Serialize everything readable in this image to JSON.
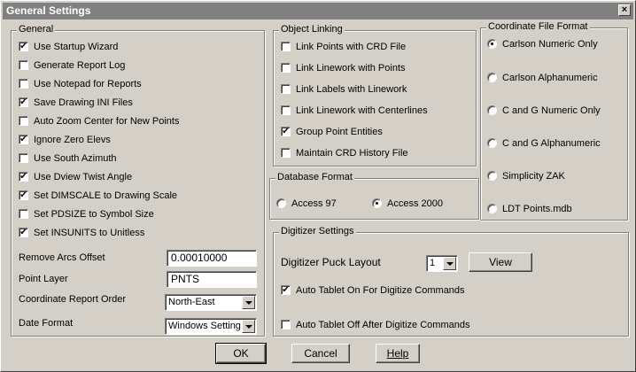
{
  "window": {
    "title": "General Settings",
    "close_glyph": "×"
  },
  "general": {
    "legend": "General",
    "items": [
      {
        "label": "Use Startup Wizard",
        "checked": true
      },
      {
        "label": "Generate Report Log",
        "checked": false
      },
      {
        "label": "Use Notepad for Reports",
        "checked": false
      },
      {
        "label": "Save Drawing INI Files",
        "checked": true
      },
      {
        "label": "Auto Zoom Center for New Points",
        "checked": false
      },
      {
        "label": "Ignore Zero Elevs",
        "checked": true
      },
      {
        "label": "Use South Azimuth",
        "checked": false
      },
      {
        "label": "Use Dview Twist Angle",
        "checked": true
      },
      {
        "label": "Set DIMSCALE to Drawing Scale",
        "checked": true
      },
      {
        "label": "Set PDSIZE to Symbol Size",
        "checked": false
      },
      {
        "label": "Set INSUNITS to Unitless",
        "checked": true
      }
    ],
    "remove_arcs_label": "Remove Arcs Offset",
    "remove_arcs_value": "0.00010000",
    "point_layer_label": "Point Layer",
    "point_layer_value": "PNTS",
    "coord_order_label": "Coordinate Report Order",
    "coord_order_value": "North-East",
    "date_format_label": "Date Format",
    "date_format_value": "Windows Setting"
  },
  "object_linking": {
    "legend": "Object Linking",
    "items": [
      {
        "label": "Link Points with CRD File",
        "checked": false
      },
      {
        "label": "Link Linework with Points",
        "checked": false
      },
      {
        "label": "Link Labels with Linework",
        "checked": false
      },
      {
        "label": "Link Linework with Centerlines",
        "checked": false
      },
      {
        "label": "Group Point Entities",
        "checked": true
      },
      {
        "label": "Maintain CRD History File",
        "checked": false
      }
    ]
  },
  "database_format": {
    "legend": "Database Format",
    "options": [
      {
        "label": "Access 97",
        "selected": false
      },
      {
        "label": "Access 2000",
        "selected": true
      }
    ]
  },
  "coord_file_format": {
    "legend": "Coordinate File Format",
    "options": [
      {
        "label": "Carlson Numeric Only",
        "selected": true
      },
      {
        "label": "Carlson Alphanumeric",
        "selected": false
      },
      {
        "label": "C and G Numeric Only",
        "selected": false
      },
      {
        "label": "C and G Alphanumeric",
        "selected": false
      },
      {
        "label": "Simplicity ZAK",
        "selected": false
      },
      {
        "label": "LDT Points.mdb",
        "selected": false
      }
    ]
  },
  "digitizer": {
    "legend": "Digitizer Settings",
    "puck_label": "Digitizer Puck Layout",
    "puck_value": "1",
    "view_button": "View",
    "auto_on_label": "Auto Tablet On For Digitize Commands",
    "auto_on_checked": true,
    "auto_off_label": "Auto Tablet Off After Digitize Commands",
    "auto_off_checked": false
  },
  "buttons": {
    "ok": "OK",
    "cancel": "Cancel",
    "help": "Help"
  },
  "glyphs": {
    "check": "✔"
  }
}
